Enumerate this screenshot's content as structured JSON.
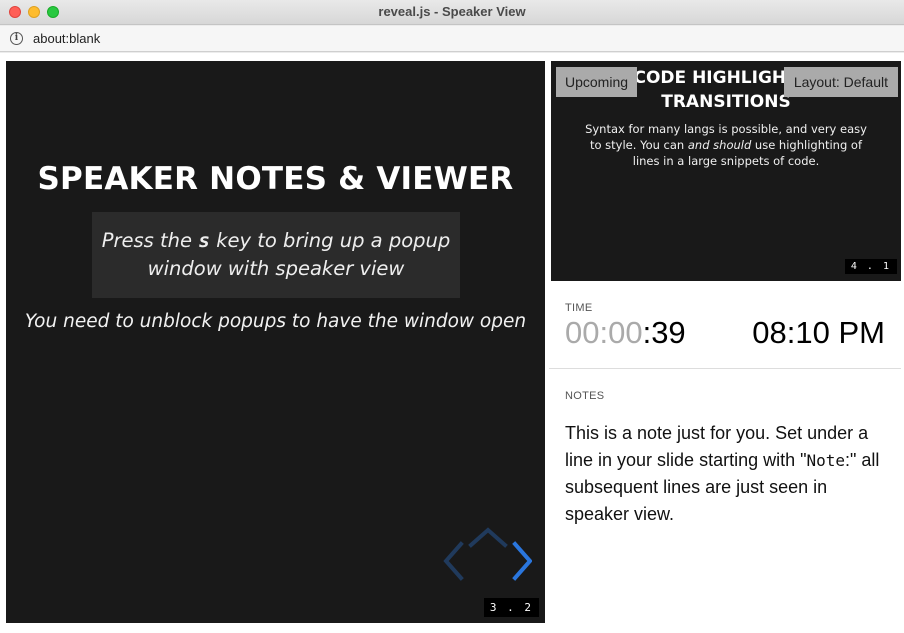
{
  "window": {
    "title": "reveal.js - Speaker View",
    "url": "about:blank",
    "traffic_colors": {
      "close": "#ff5f57",
      "minimize": "#febc2e",
      "maximize": "#28c840"
    }
  },
  "current_slide": {
    "heading": "SPEAKER NOTES & VIEWER",
    "box_line1_before": "Press the",
    "box_key": "s",
    "box_line1_after": "key to bring up a popup",
    "box_line2": "window with speaker view",
    "footer": "You need to unblock popups to have the window open",
    "slide_number": "3 . 2",
    "background": "#191919",
    "controls": {
      "up": "disabled",
      "left": "disabled",
      "right": "enabled",
      "enabled_color": "#2a76dd",
      "disabled_color": "#203a5c"
    }
  },
  "upcoming_slide": {
    "label": "Upcoming",
    "layout_button": "Layout: Default",
    "heading_line1": "CODE HIGHLIGHT &",
    "heading_line2": "TRANSITIONS",
    "body_before": "Syntax for many langs is possible, and very easy to style. You can ",
    "body_emphasis": "and should",
    "body_after": " use highlighting of lines in a large snippets of code.",
    "slide_number": "4 . 1"
  },
  "time": {
    "label": "TIME",
    "timer_dim": "00:00",
    "timer_active": ":39",
    "clock": "08:10 PM"
  },
  "notes": {
    "label": "NOTES",
    "text_before": "This is a note just for you. Set under a line in your slide starting with \"",
    "code": "Note",
    "text_after": ":\" all subsequent lines are just seen in speaker view."
  }
}
